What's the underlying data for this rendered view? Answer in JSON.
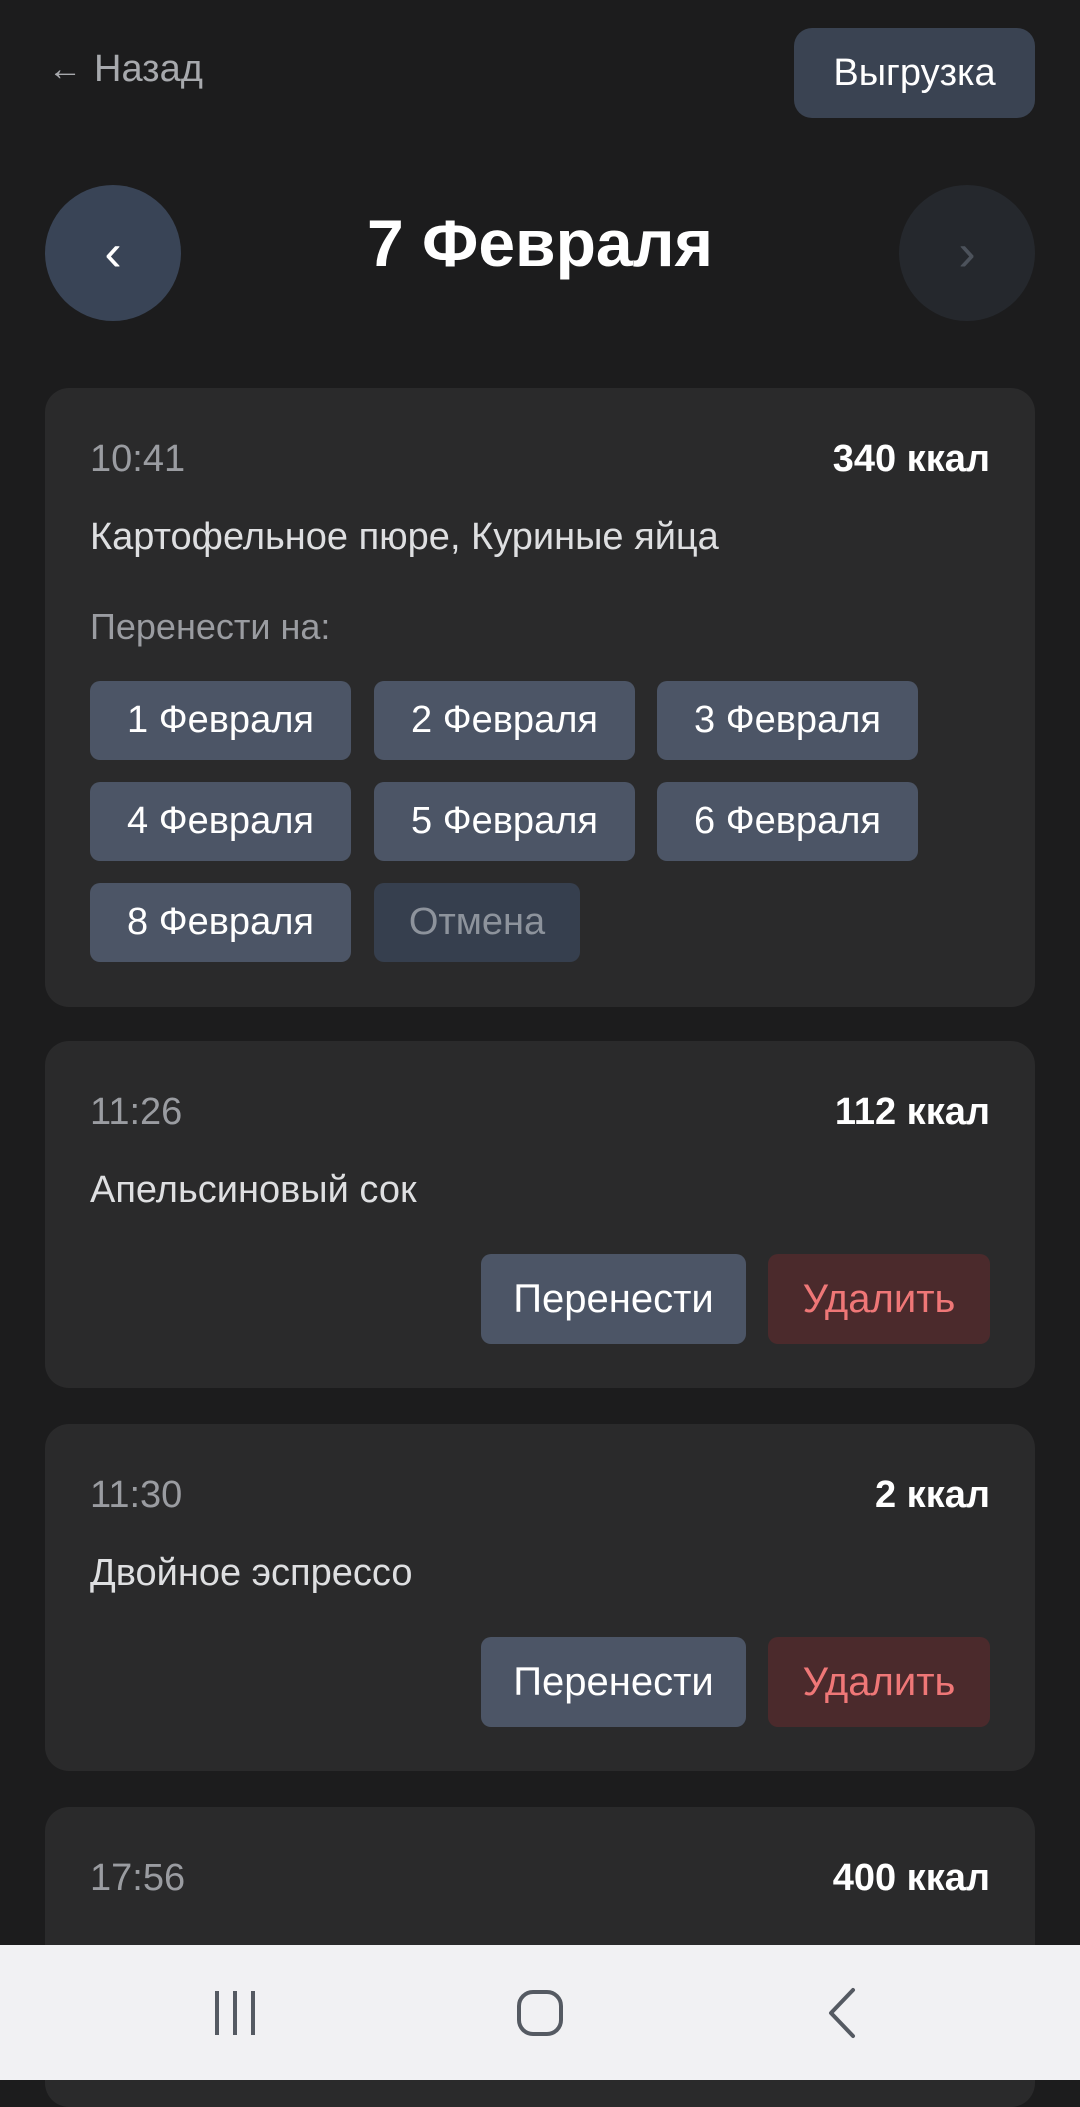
{
  "header": {
    "back_arrow": "←",
    "back_label": "Назад",
    "export_label": "Выгрузка"
  },
  "date_nav": {
    "prev_glyph": "‹",
    "title": "7 Февраля",
    "next_glyph": "›"
  },
  "entries": [
    {
      "time": "10:41",
      "kcal": "340 ккал",
      "food": "Картофельное пюре, Куриные яйца",
      "move_mode": true,
      "move_label": "Перенести на:",
      "move_options": [
        "1 Февраля",
        "2 Февраля",
        "3 Февраля",
        "4 Февраля",
        "5 Февраля",
        "6 Февраля",
        "8 Февраля"
      ],
      "cancel_label": "Отмена"
    },
    {
      "time": "11:26",
      "kcal": "112 ккал",
      "food": "Апельсиновый сок",
      "move_label": "Перенести",
      "delete_label": "Удалить"
    },
    {
      "time": "11:30",
      "kcal": "2 ккал",
      "food": "Двойное эспрессо",
      "move_label": "Перенести",
      "delete_label": "Удалить"
    },
    {
      "time": "17:56",
      "kcal": "400 ккал"
    }
  ],
  "system_nav": {
    "recent_icon": "recent-apps-icon",
    "home_icon": "home-icon",
    "back_icon": "back-icon"
  },
  "colors": {
    "background": "#1c1c1d",
    "card": "#2a2a2b",
    "button": "#4c5566",
    "delete_text": "#ef7777",
    "delete_bg": "#4b2a2c"
  }
}
